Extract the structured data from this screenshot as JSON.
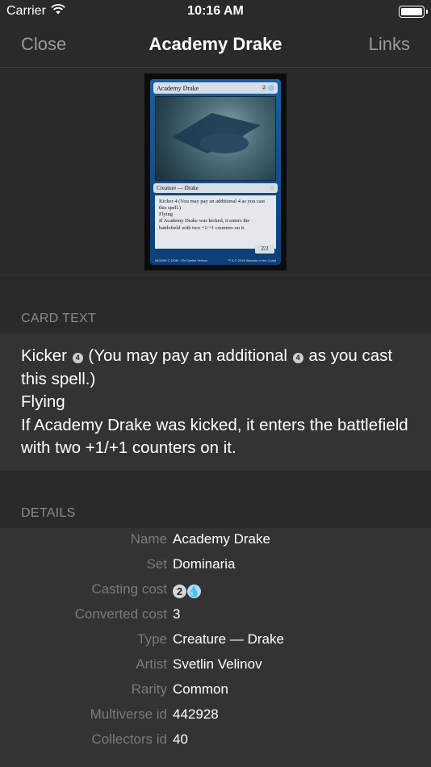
{
  "status_bar": {
    "carrier": "Carrier",
    "time": "10:16 AM"
  },
  "nav": {
    "close_label": "Close",
    "title": "Academy Drake",
    "links_label": "Links"
  },
  "card_image": {
    "name": "Academy Drake",
    "type_line": "Creature — Drake",
    "rules_kicker": "Kicker 4 (You may pay an additional 4 as you cast this spell.)",
    "rules_flying": "Flying",
    "rules_kicked": "If Academy Drake was kicked, it enters the battlefield with two +1/+1 counters on it.",
    "power_toughness": "2/2",
    "footer_left": "040/269 C  DOM · EN  Svetlin Velinov",
    "footer_right": "™ & © 2018 Wizards of the Coast"
  },
  "card_text": {
    "header": "CARD TEXT",
    "kicker_prefix": "Kicker",
    "kicker_symbol": "4",
    "kicker_mid": "(You may pay an additional",
    "kicker_symbol2": "4",
    "kicker_suffix": "as you cast this spell.)",
    "flying": "Flying",
    "kicked_text": "If Academy Drake was kicked, it enters the battlefield with two +1/+1 counters on it."
  },
  "details": {
    "header": "DETAILS",
    "rows": [
      {
        "label": "Name",
        "value": "Academy Drake"
      },
      {
        "label": "Set",
        "value": "Dominaria"
      },
      {
        "label": "Casting cost",
        "value": ""
      },
      {
        "label": "Converted cost",
        "value": "3"
      },
      {
        "label": "Type",
        "value": "Creature — Drake"
      },
      {
        "label": "Artist",
        "value": "Svetlin Velinov"
      },
      {
        "label": "Rarity",
        "value": "Common"
      },
      {
        "label": "Multiverse id",
        "value": "442928"
      },
      {
        "label": "Collectors id",
        "value": "40"
      }
    ],
    "casting_cost_generic": "2",
    "casting_cost_blue": "💧"
  },
  "colors": {
    "background": "#2a2a2a",
    "section_background": "#333333",
    "header_text": "#8a8a8a"
  }
}
